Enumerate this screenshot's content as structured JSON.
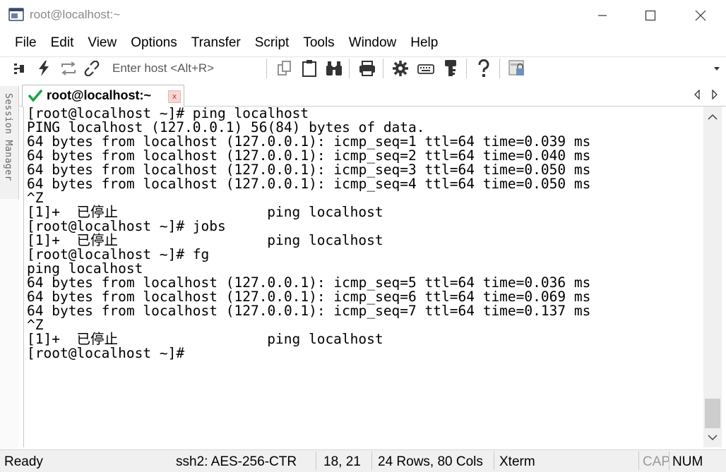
{
  "window": {
    "title": "root@localhost:~"
  },
  "menu": [
    "File",
    "Edit",
    "View",
    "Options",
    "Transfer",
    "Script",
    "Tools",
    "Window",
    "Help"
  ],
  "toolbar": {
    "host_placeholder": "Enter host <Alt+R>",
    "icons": [
      "connect-icon",
      "quick-connect-icon",
      "reconnect-icon",
      "disconnect-icon",
      "copy-icon",
      "paste-icon",
      "find-icon",
      "print-icon",
      "settings-icon",
      "keymap-icon",
      "sftp-key-icon",
      "help-icon",
      "lock-screen-icon"
    ]
  },
  "sidebar": {
    "session_manager_label": "Session Manager"
  },
  "tab": {
    "label": "root@localhost:~",
    "close_glyph": "x"
  },
  "terminal": {
    "lines": [
      "[root@localhost ~]# ping localhost",
      "PING localhost (127.0.0.1) 56(84) bytes of data.",
      "64 bytes from localhost (127.0.0.1): icmp_seq=1 ttl=64 time=0.039 ms",
      "64 bytes from localhost (127.0.0.1): icmp_seq=2 ttl=64 time=0.040 ms",
      "64 bytes from localhost (127.0.0.1): icmp_seq=3 ttl=64 time=0.050 ms",
      "64 bytes from localhost (127.0.0.1): icmp_seq=4 ttl=64 time=0.050 ms",
      "^Z",
      "[1]+  已停止                  ping localhost",
      "[root@localhost ~]# jobs",
      "[1]+  已停止                  ping localhost",
      "[root@localhost ~]# fg",
      "ping localhost",
      "64 bytes from localhost (127.0.0.1): icmp_seq=5 ttl=64 time=0.036 ms",
      "64 bytes from localhost (127.0.0.1): icmp_seq=6 ttl=64 time=0.069 ms",
      "64 bytes from localhost (127.0.0.1): icmp_seq=7 ttl=64 time=0.137 ms",
      "^Z",
      "[1]+  已停止                  ping localhost",
      "[root@localhost ~]#"
    ]
  },
  "status": {
    "state": "Ready",
    "cipher": "ssh2: AES-256-CTR",
    "cursor": "18,  21",
    "size": "24 Rows, 80 Cols",
    "terminal_type": "Xterm",
    "cap": "CAP",
    "num": "NUM"
  },
  "colors": {
    "accent_check": "#1aa34a",
    "tab_close_red": "#d9342b",
    "status_bg": "#f0f0f0"
  }
}
